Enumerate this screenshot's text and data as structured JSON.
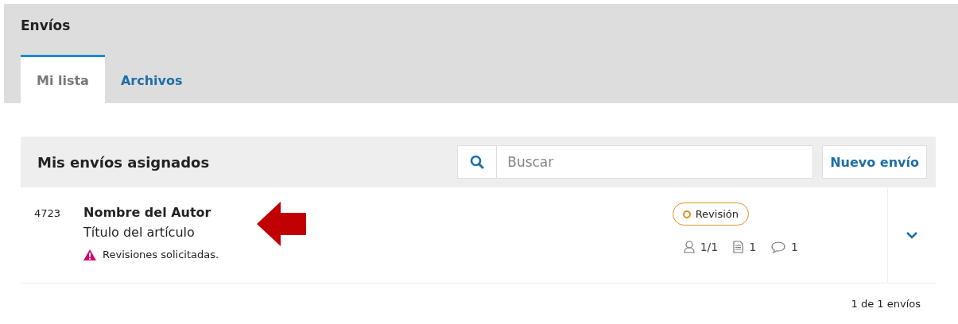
{
  "page": {
    "title": "Envíos"
  },
  "tabs": [
    {
      "label": "Mi lista",
      "selected": true
    },
    {
      "label": "Archivos",
      "selected": false
    }
  ],
  "panel": {
    "title": "Mis envíos asignados",
    "search": {
      "placeholder": "Buscar"
    },
    "new_button": "Nuevo envío"
  },
  "submissions": [
    {
      "id": "4723",
      "author": "Nombre del Autor",
      "title": "Título del artículo",
      "notice": "Revisiones solicitadas.",
      "stage": "Revisión",
      "participants": "1/1",
      "files": "1",
      "discussions": "1",
      "expanded": false
    }
  ],
  "pagination": "1 de 1 envíos"
}
